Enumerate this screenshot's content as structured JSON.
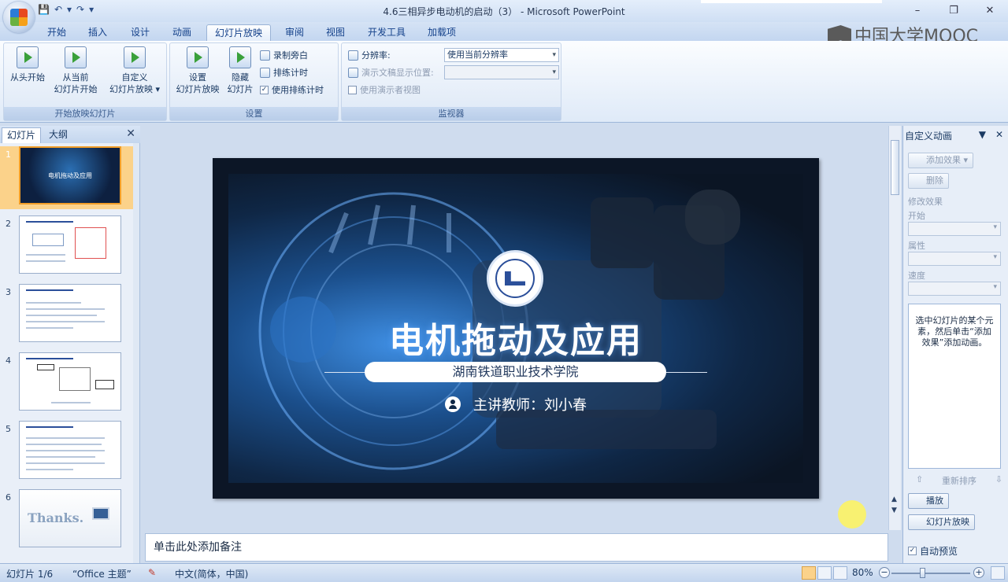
{
  "window": {
    "title": "4.6三相异步电动机的启动（3） - Microsoft PowerPoint",
    "controls": [
      "–",
      "❐",
      "✕"
    ]
  },
  "qat": [
    "💾",
    "↶",
    "▾",
    "↷",
    "▾"
  ],
  "tabs": [
    "开始",
    "插入",
    "设计",
    "动画",
    "幻灯片放映",
    "审阅",
    "视图",
    "开发工具",
    "加载项"
  ],
  "active_tab": "幻灯片放映",
  "watermark": "中国大学MOOC",
  "ribbon": {
    "group1": {
      "label": "开始放映幻灯片",
      "buttons": [
        {
          "line1": "从头开始",
          "line2": ""
        },
        {
          "line1": "从当前",
          "line2": "幻灯片开始"
        },
        {
          "line1": "自定义",
          "line2": "幻灯片放映 ▾"
        }
      ]
    },
    "group2": {
      "label": "设置",
      "buttons": [
        {
          "line1": "设置",
          "line2": "幻灯片放映"
        },
        {
          "line1": "隐藏",
          "line2": "幻灯片"
        }
      ],
      "small": [
        "录制旁白",
        "排练计时",
        "使用排练计时"
      ],
      "rehearse_checked": "✓"
    },
    "group3": {
      "label": "监视器",
      "resolution_label": "分辨率:",
      "resolution_value": "使用当前分辨率",
      "position_label": "演示文稿显示位置:",
      "presenter_view": "使用演示者视图"
    }
  },
  "left_panel": {
    "tabs": [
      "幻灯片",
      "大纲"
    ],
    "close": "✕",
    "slides": [
      "1",
      "2",
      "3",
      "4",
      "5",
      "6"
    ],
    "thumb1_title": "电机拖动及应用",
    "thumb6_text": "Thanks."
  },
  "slide": {
    "title": "电机拖动及应用",
    "subtitle": "湖南铁道职业技术学院",
    "teacher": "主讲教师：刘小春"
  },
  "notes_placeholder": "单击此处添加备注",
  "right_pane": {
    "title": "自定义动画",
    "add_effect": "添加效果 ▾",
    "remove": "删除",
    "modify_label": "修改效果",
    "start_label": "开始",
    "property_label": "属性",
    "speed_label": "速度",
    "hint": "选中幻灯片的某个元素，然后单击“添加效果”添加动画。",
    "reorder": "重新排序",
    "play": "播放",
    "slideshow": "幻灯片放映",
    "auto_preview": "自动预览",
    "auto_checked": "✓"
  },
  "status": {
    "slide_info": "幻灯片 1/6",
    "theme": "“Office 主题”",
    "language": "中文(简体，中国)",
    "zoom": "80%"
  }
}
